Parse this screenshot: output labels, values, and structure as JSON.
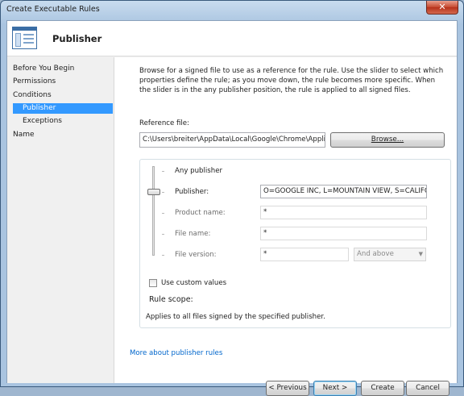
{
  "window": {
    "title": "Create Executable Rules",
    "close_glyph": "✕"
  },
  "header": {
    "title": "Publisher",
    "icon": "rules-window-icon"
  },
  "sidebar": {
    "items": [
      {
        "label": "Before You Begin",
        "selected": false
      },
      {
        "label": "Permissions",
        "selected": false
      },
      {
        "label": "Conditions",
        "selected": false
      },
      {
        "label": "Publisher",
        "selected": true
      },
      {
        "label": "Exceptions",
        "selected": false
      },
      {
        "label": "Name",
        "selected": false
      }
    ]
  },
  "main": {
    "description": "Browse for a signed file to use as a reference for the rule. Use the slider to select which properties define the rule; as you move down, the rule becomes more specific. When the slider is in the any publisher position, the rule is applied to all signed files.",
    "reference_label": "Reference file:",
    "reference_value": "C:\\Users\\breiter\\AppData\\Local\\Google\\Chrome\\Applica",
    "browse_label": "Browse...",
    "levels": {
      "any_publisher": "Any publisher",
      "publisher_label": "Publisher:",
      "publisher_value": "O=GOOGLE INC, L=MOUNTAIN VIEW, S=CALIFOR",
      "product_label": "Product name:",
      "product_value": "*",
      "file_label": "File name:",
      "file_value": "*",
      "version_label": "File version:",
      "version_value": "*",
      "version_op": "And above"
    },
    "slider_position": "Publisher",
    "custom_values_label": "Use custom values",
    "custom_values_checked": false,
    "scope_title": "Rule scope:",
    "scope_text": "Applies to all files signed by the specified publisher.",
    "more_link": "More about publisher rules"
  },
  "buttons": {
    "previous": "< Previous",
    "next": "Next >",
    "create": "Create",
    "cancel": "Cancel"
  },
  "colors": {
    "selection": "#3399ff",
    "link": "#0066cc"
  }
}
